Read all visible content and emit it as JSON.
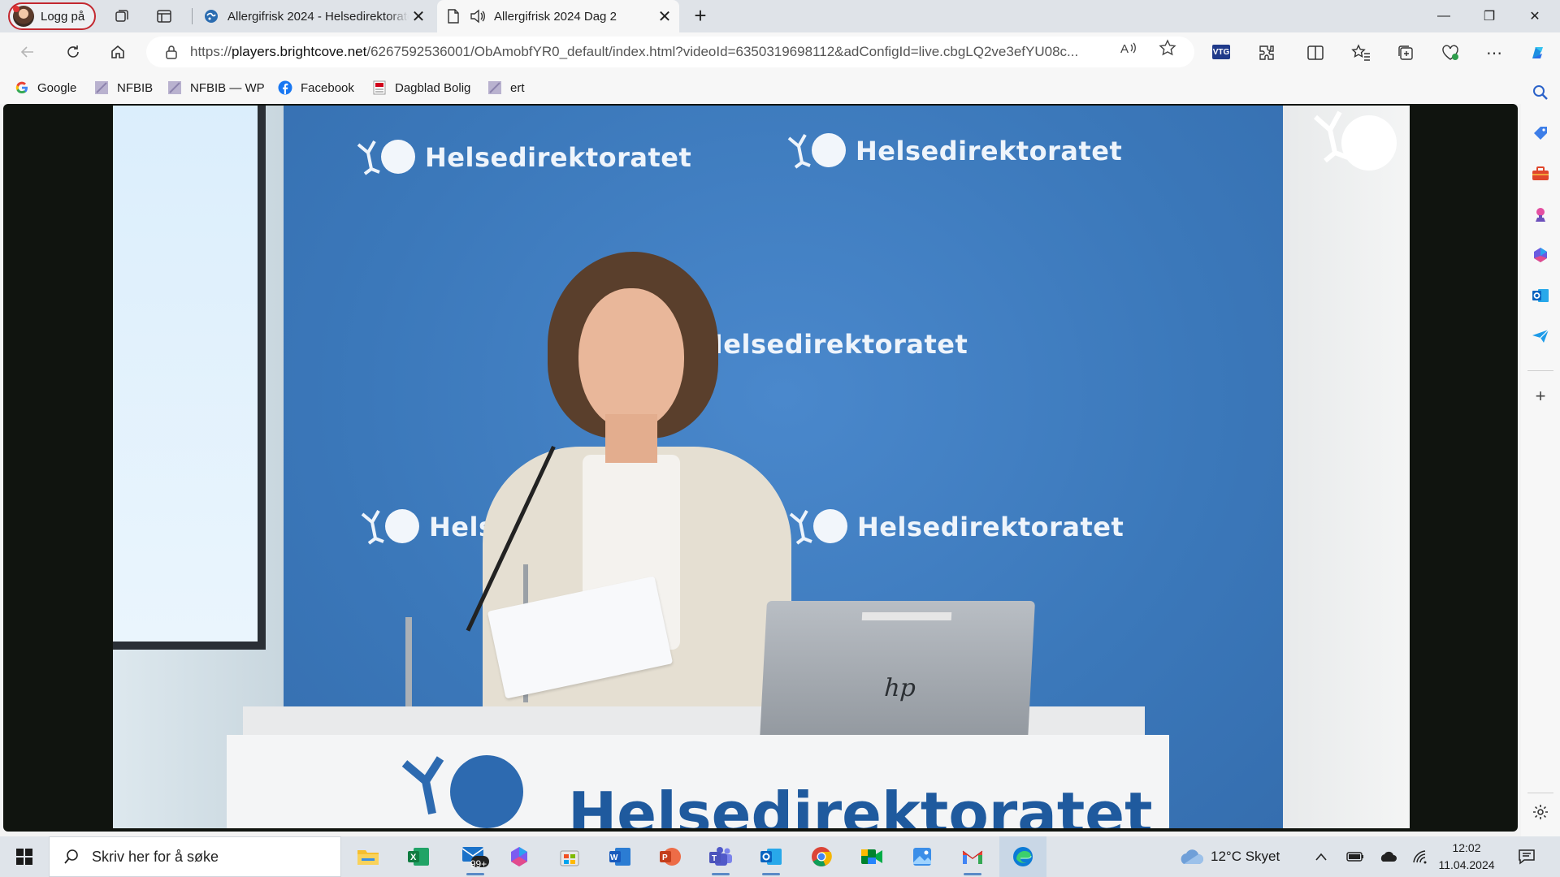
{
  "profile": {
    "label": "Logg på"
  },
  "tabs": [
    {
      "title": "Allergifrisk 2024 - Helsedirektoratet",
      "close": "✕"
    },
    {
      "title": "Allergifrisk 2024 Dag 2",
      "close": "✕"
    }
  ],
  "new_tab": "+",
  "window": {
    "minimize": "—",
    "maximize": "❐",
    "close": "✕"
  },
  "address": {
    "url_prefix": "https://",
    "url_host": "players.brightcove.net",
    "url_path": "/6267592536001/ObAmobfYR0_default/index.html?videoId=6350319698112&adConfigId=live.cbgLQ2ve3efYU08c..."
  },
  "extensions": {
    "vtg_label": "VTG"
  },
  "bookmarks": [
    {
      "label": "Google"
    },
    {
      "label": "NFBIB"
    },
    {
      "label": "NFBIB — WP"
    },
    {
      "label": "Facebook"
    },
    {
      "label": "Dagblad Bolig"
    },
    {
      "label": "ert"
    }
  ],
  "video": {
    "backdrop_brand": "Helsedirektoratet",
    "backdrop_brand_partial": "Helse",
    "podium_brand": "Helsedirektoratet"
  },
  "taskbar": {
    "search_placeholder": "Skriv her for å søke",
    "mail_badge": "99+",
    "weather": "12°C  Skyet",
    "time": "12:02",
    "date": "11.04.2024"
  },
  "colors": {
    "accent": "#1a73c8",
    "backdrop_blue": "#3b78ba",
    "profile_border": "#c3282f"
  }
}
